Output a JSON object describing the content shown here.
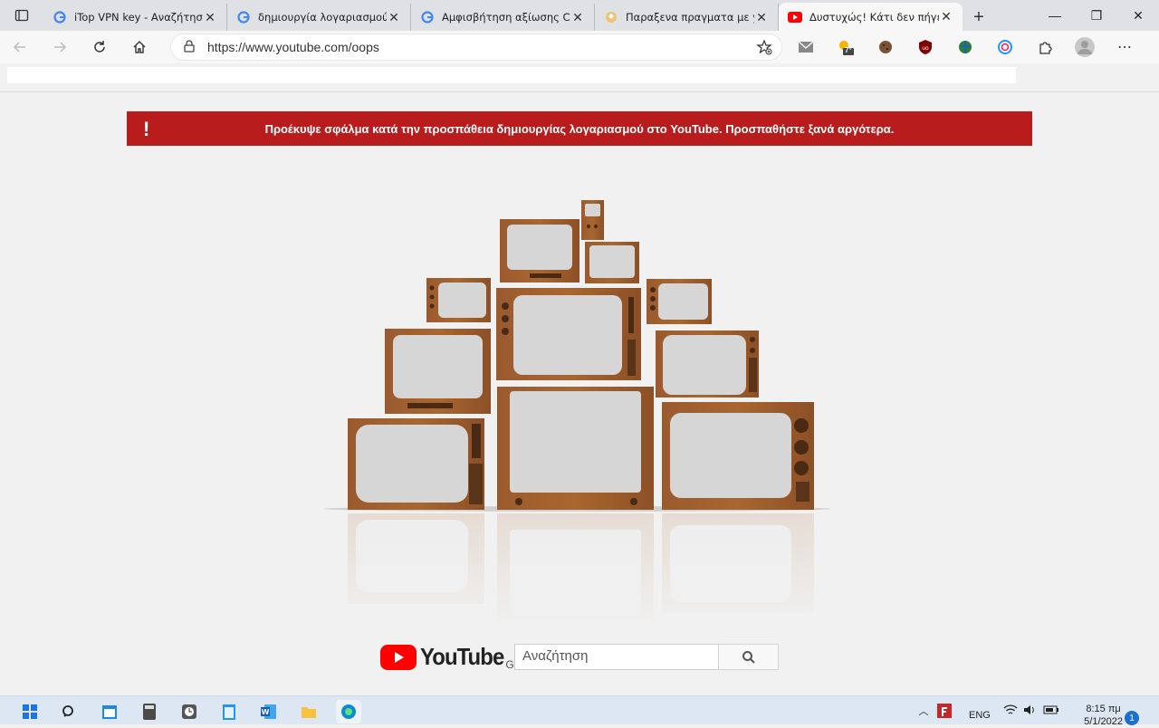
{
  "browser": {
    "tabs": [
      {
        "title": "iTop VPN key - Αναζήτηση",
        "favicon": "google-icon"
      },
      {
        "title": "δημιουργία λογαριασμού",
        "favicon": "google-icon"
      },
      {
        "title": "Αμφισβήτηση αξίωσης Co",
        "favicon": "google-icon"
      },
      {
        "title": "Παραξενα πραγματα με y",
        "favicon": "generic-icon"
      },
      {
        "title": "Δυστυχώς! Κάτι δεν πήγε",
        "favicon": "youtube-icon",
        "active": true
      }
    ],
    "address": "https://www.youtube.com/oops",
    "weather_badge": "7°"
  },
  "page": {
    "alert_text": "Προέκυψε σφάλμα κατά την προσπάθεια δημιουργίας λογαριασμού στο YouTube. Προσπαθήστε ξανά αργότερα.",
    "alert_icon": "!",
    "brand": "YouTube",
    "region": "GR",
    "search_placeholder": "Αναζήτηση",
    "alert_color": "#b91c1c"
  },
  "taskbar": {
    "lang": "ENG",
    "time": "8:15 πμ",
    "date": "5/1/2022",
    "notifications": "1"
  }
}
